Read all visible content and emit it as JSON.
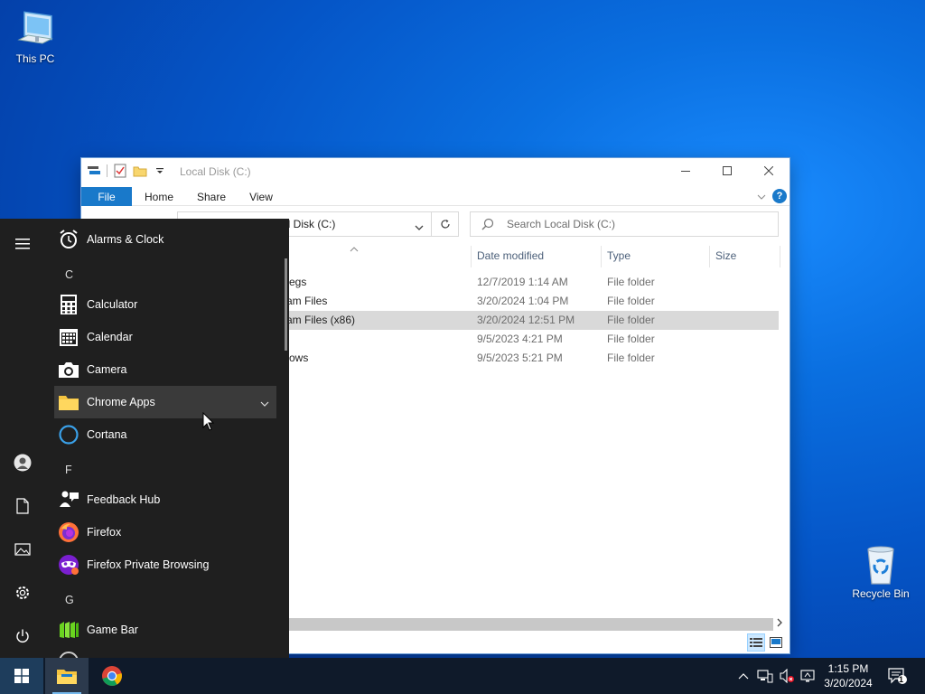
{
  "desktop": {
    "icons": [
      {
        "label": "This PC",
        "icon": "this-pc-icon"
      },
      {
        "label": "Recycle Bin",
        "icon": "recycle-bin-icon"
      }
    ]
  },
  "explorer": {
    "title": "Local Disk (C:)",
    "ribbon_tabs": [
      "File",
      "Home",
      "Share",
      "View"
    ],
    "address_visible": "al Disk (C:)",
    "search_placeholder": "Search Local Disk (C:)",
    "columns": [
      "Date modified",
      "Type",
      "Size"
    ],
    "rows": [
      {
        "name_fragment": "egs",
        "date": "12/7/2019 1:14 AM",
        "type": "File folder"
      },
      {
        "name_fragment": "am Files",
        "date": "3/20/2024 1:04 PM",
        "type": "File folder"
      },
      {
        "name_fragment": "am Files (x86)",
        "date": "3/20/2024 12:51 PM",
        "type": "File folder",
        "selected": true
      },
      {
        "name_fragment": "",
        "date": "9/5/2023 4:21 PM",
        "type": "File folder"
      },
      {
        "name_fragment": "ows",
        "date": "9/5/2023 5:21 PM",
        "type": "File folder"
      }
    ]
  },
  "start_menu": {
    "rail_icons": [
      "hamburger-icon",
      "user-icon",
      "documents-icon",
      "pictures-icon",
      "settings-icon",
      "power-icon"
    ],
    "items": [
      {
        "kind": "app",
        "label": "Alarms & Clock",
        "icon": "alarm-clock-icon"
      },
      {
        "kind": "letter",
        "label": "C"
      },
      {
        "kind": "app",
        "label": "Calculator",
        "icon": "calculator-icon"
      },
      {
        "kind": "app",
        "label": "Calendar",
        "icon": "calendar-icon"
      },
      {
        "kind": "app",
        "label": "Camera",
        "icon": "camera-icon"
      },
      {
        "kind": "folder",
        "label": "Chrome Apps",
        "icon": "folder-icon",
        "hover": true
      },
      {
        "kind": "app",
        "label": "Cortana",
        "icon": "cortana-icon"
      },
      {
        "kind": "letter",
        "label": "F"
      },
      {
        "kind": "app",
        "label": "Feedback Hub",
        "icon": "feedback-hub-icon"
      },
      {
        "kind": "app",
        "label": "Firefox",
        "icon": "firefox-icon"
      },
      {
        "kind": "app",
        "label": "Firefox Private Browsing",
        "icon": "firefox-private-icon"
      },
      {
        "kind": "letter",
        "label": "G"
      },
      {
        "kind": "app",
        "label": "Game Bar",
        "icon": "game-bar-icon"
      }
    ]
  },
  "taskbar": {
    "pinned": [
      "windows-start-icon",
      "file-explorer-icon",
      "chrome-icon"
    ],
    "tray": [
      "chevron-up-icon",
      "network-icon",
      "volume-muted-icon",
      "display-icon"
    ],
    "time": "1:15 PM",
    "date": "3/20/2024",
    "notification_count": "1"
  }
}
